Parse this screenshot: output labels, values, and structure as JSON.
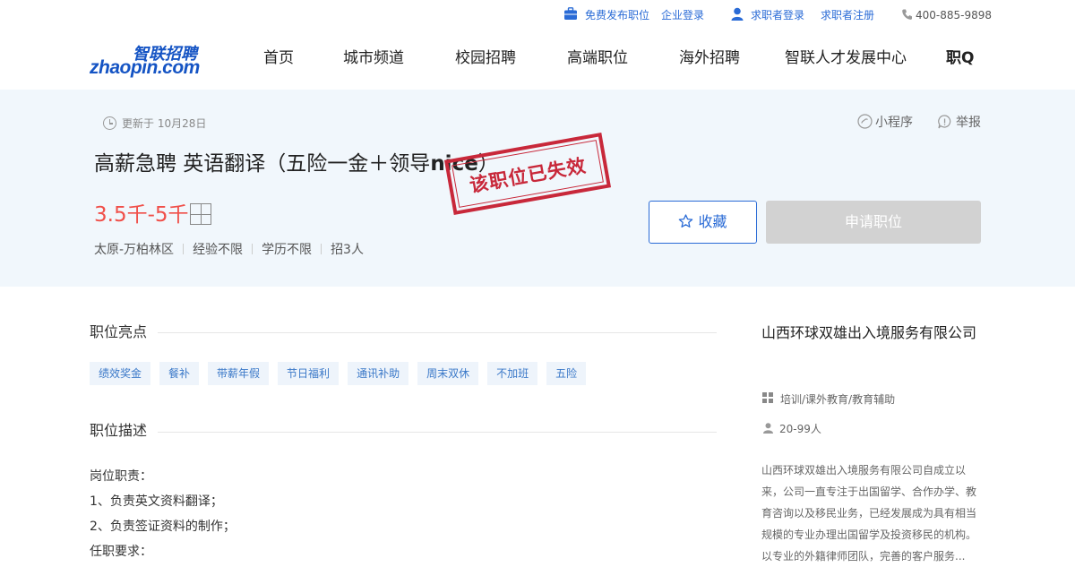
{
  "topbar": {
    "post_job": "免费发布职位",
    "company_login": "企业登录",
    "seeker_login": "求职者登录",
    "seeker_register": "求职者注册",
    "hotline": "400-885-9898"
  },
  "logo": {
    "en": "zhaopin.com",
    "cn": "智联招聘"
  },
  "nav": {
    "items": [
      "首页",
      "城市频道",
      "校园招聘",
      "高端职位",
      "海外招聘",
      "智联人才发展中心",
      "职Q"
    ]
  },
  "job": {
    "updated": "更新于 10月28日",
    "title_prefix": "高薪急聘 英语翻译（五险一金＋领导",
    "title_bold": "nice",
    "title_suffix": "）",
    "salary": "3.5千-5千",
    "location": "太原-万柏林区",
    "experience": "经验不限",
    "education": "学历不限",
    "headcount": "招3人",
    "stamp": "该职位已失效",
    "mini_program": "小程序",
    "report": "举报",
    "favorite": "收藏",
    "apply": "申请职位"
  },
  "highlights": {
    "heading": "职位亮点",
    "tags": [
      "绩效奖金",
      "餐补",
      "带薪年假",
      "节日福利",
      "通讯补助",
      "周末双休",
      "不加班",
      "五险"
    ]
  },
  "description": {
    "heading": "职位描述",
    "lines": [
      "岗位职责：",
      "1、负责英文资料翻译；",
      "2、负责签证资料的制作；",
      "任职要求："
    ]
  },
  "company": {
    "name": "山西环球双雄出入境服务有限公司",
    "industry": "培训/课外教育/教育辅助",
    "size": "20-99人",
    "intro": "山西环球双雄出入境服务有限公司自成立以来，公司一直专注于出国留学、合作办学、教育咨询以及移民业务，已经发展成为具有相当规模的专业办理出国留学及投资移民的机构。以专业的外籍律师团队，完善的客户服务..."
  },
  "colors": {
    "brand_blue": "#2a6bd6",
    "salary_red": "#f04f49",
    "stamp_red": "#c8283a",
    "hero_bg": "#f1f7fc"
  }
}
